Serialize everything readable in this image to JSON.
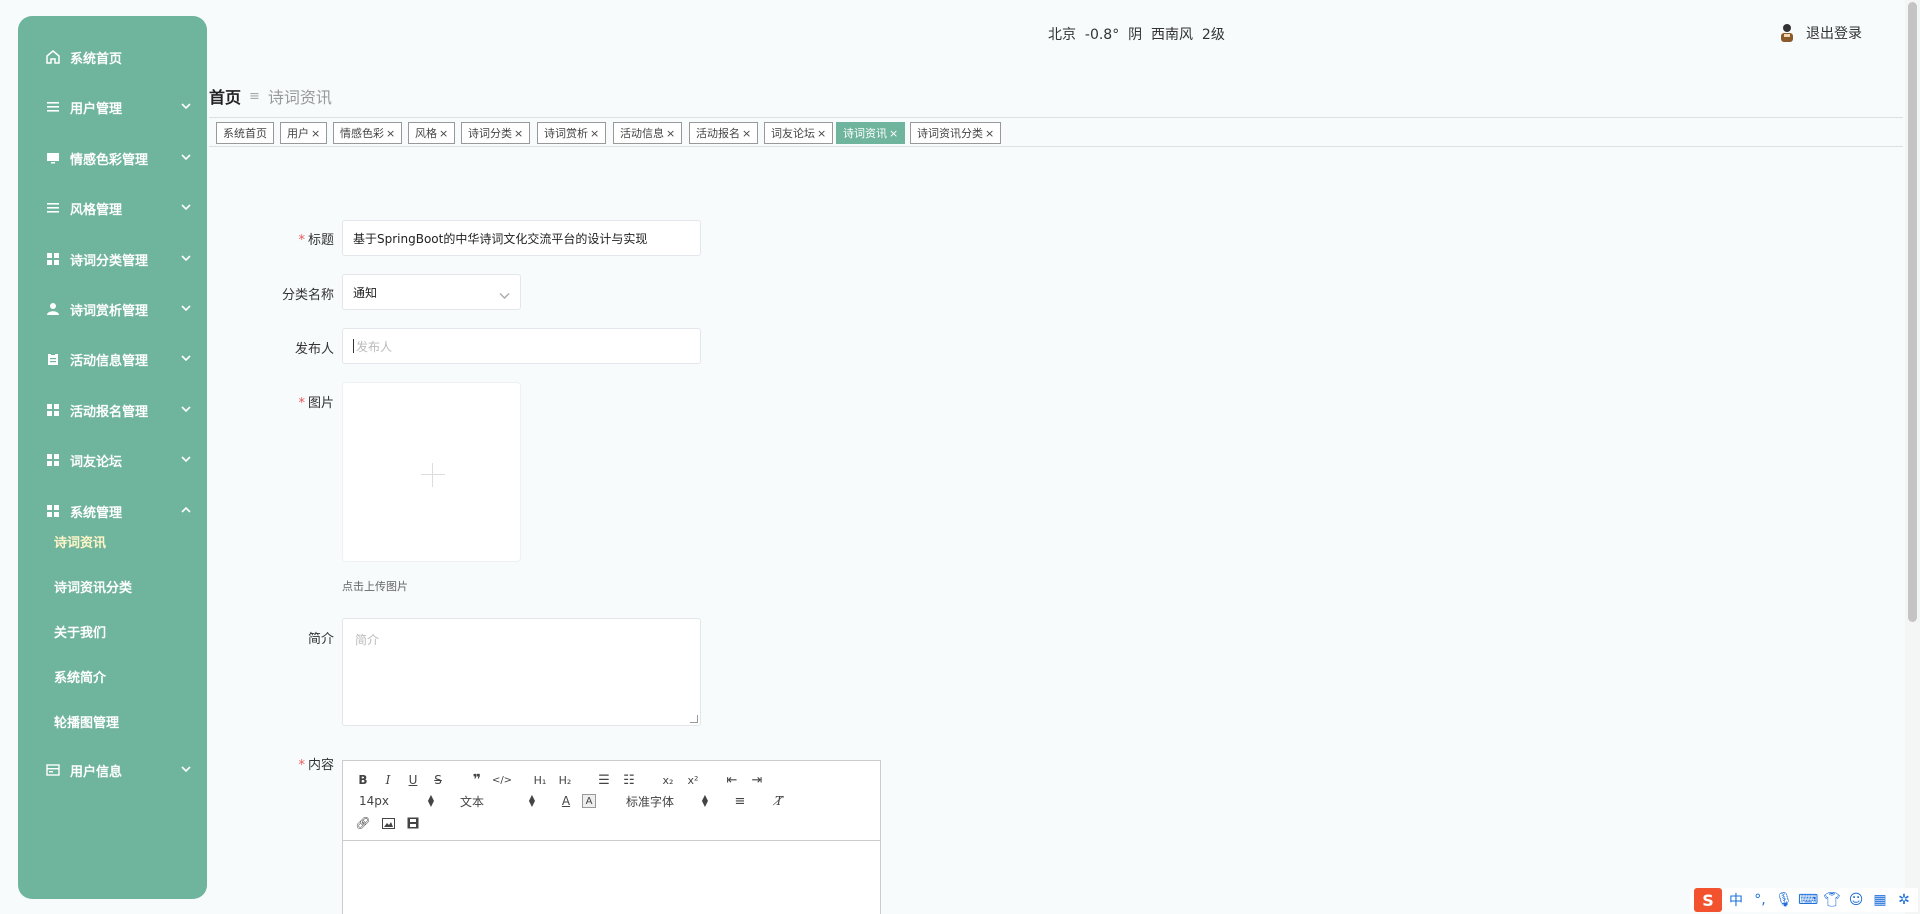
{
  "sidebar": {
    "items": [
      {
        "label": "系统首页",
        "icon": "home-icon"
      },
      {
        "label": "用户管理",
        "icon": "list-icon"
      },
      {
        "label": "情感色彩管理",
        "icon": "monitor-icon"
      },
      {
        "label": "风格管理",
        "icon": "list-icon"
      },
      {
        "label": "诗词分类管理",
        "icon": "grid-icon"
      },
      {
        "label": "诗词赏析管理",
        "icon": "user-icon"
      },
      {
        "label": "活动信息管理",
        "icon": "clipboard-icon"
      },
      {
        "label": "活动报名管理",
        "icon": "grid-icon"
      },
      {
        "label": "词友论坛",
        "icon": "grid-icon"
      },
      {
        "label": "系统管理",
        "icon": "grid-icon"
      }
    ],
    "sub_items": [
      "诗词资讯",
      "诗词资讯分类",
      "关于我们",
      "系统简介",
      "轮播图管理"
    ],
    "last_item": {
      "label": "用户信息",
      "icon": "card-icon"
    }
  },
  "header": {
    "weather": "北京  -0.8°  阴  西南风  2级",
    "logout": "退出登录"
  },
  "breadcrumb": {
    "home": "首页",
    "separator": "≡",
    "current": "诗词资讯"
  },
  "tags": [
    {
      "label": "系统首页",
      "closable": false
    },
    {
      "label": "用户",
      "closable": true
    },
    {
      "label": "情感色彩",
      "closable": true
    },
    {
      "label": "风格",
      "closable": true
    },
    {
      "label": "诗词分类",
      "closable": true
    },
    {
      "label": "诗词赏析",
      "closable": true
    },
    {
      "label": "活动信息",
      "closable": true
    },
    {
      "label": "活动报名",
      "closable": true
    },
    {
      "label": "词友论坛",
      "closable": true
    },
    {
      "label": "诗词资讯",
      "closable": true,
      "active": true
    },
    {
      "label": "诗词资讯分类",
      "closable": true
    }
  ],
  "form": {
    "title": {
      "label": "标题",
      "value": "基于SpringBoot的中华诗词文化交流平台的设计与实现"
    },
    "category": {
      "label": "分类名称",
      "value": "通知"
    },
    "publisher": {
      "label": "发布人",
      "placeholder": "发布人"
    },
    "image": {
      "label": "图片",
      "hint": "点击上传图片"
    },
    "summary": {
      "label": "简介",
      "placeholder": "简介"
    },
    "content": {
      "label": "内容"
    }
  },
  "editor": {
    "font_size": "14px",
    "text_type": "文本",
    "font_family": "标准字体"
  },
  "ime": {
    "lang": "中"
  },
  "colors": {
    "accent": "#6fb49c",
    "sub_active": "#fff6c8",
    "required": "#e55555"
  }
}
